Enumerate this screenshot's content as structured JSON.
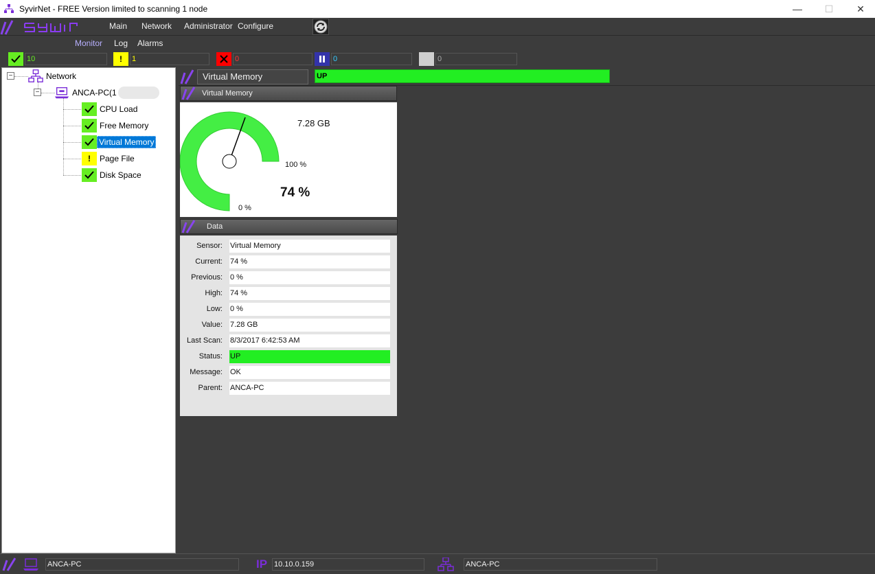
{
  "window": {
    "title": "SyvirNet - FREE Version limited to scanning 1 node",
    "minimize": "—",
    "maximize": "☐",
    "close": "✕"
  },
  "menu": {
    "items": [
      "Main",
      "Network",
      "Administrator",
      "Configure"
    ],
    "sub_items": [
      "Monitor",
      "Log",
      "Alarms"
    ]
  },
  "counts": {
    "ok": "10",
    "warning": "1",
    "error": "0",
    "paused": "0",
    "unknown": "0"
  },
  "tree": {
    "root": "Network",
    "node": "ANCA-PC(1",
    "sensors": [
      "CPU Load",
      "Free Memory",
      "Virtual Memory",
      "Page File",
      "Disk Space"
    ]
  },
  "sensor_header": {
    "name": "Virtual Memory",
    "status": "UP"
  },
  "gauge_panel": {
    "title": "Virtual Memory",
    "value_text": "7.28 GB",
    "max_label": "100 %",
    "min_label": "0 %",
    "percent_text": "74 %",
    "percent": 74
  },
  "data_panel": {
    "title": "Data",
    "rows": [
      {
        "label": "Sensor:",
        "value": "Virtual Memory"
      },
      {
        "label": "Current:",
        "value": "74 %"
      },
      {
        "label": "Previous:",
        "value": "0 %"
      },
      {
        "label": "High:",
        "value": "74 %"
      },
      {
        "label": "Low:",
        "value": "0 %"
      },
      {
        "label": "Value:",
        "value": "7.28 GB"
      },
      {
        "label": "Last Scan:",
        "value": "8/3/2017 6:42:53 AM"
      },
      {
        "label": "Status:",
        "value": "UP"
      },
      {
        "label": "Message:",
        "value": "OK"
      },
      {
        "label": "Parent:",
        "value": "ANCA-PC"
      }
    ]
  },
  "bottom_bar": {
    "host": "ANCA-PC",
    "ip_label": "IP",
    "ip": "10.10.0.159",
    "network": "ANCA-PC"
  },
  "colors": {
    "ok": "#66ee22",
    "warning": "#ffff00",
    "error": "#ff0000",
    "paused": "#3333aa",
    "accent": "#7a2dd8",
    "up": "#22ee22"
  }
}
